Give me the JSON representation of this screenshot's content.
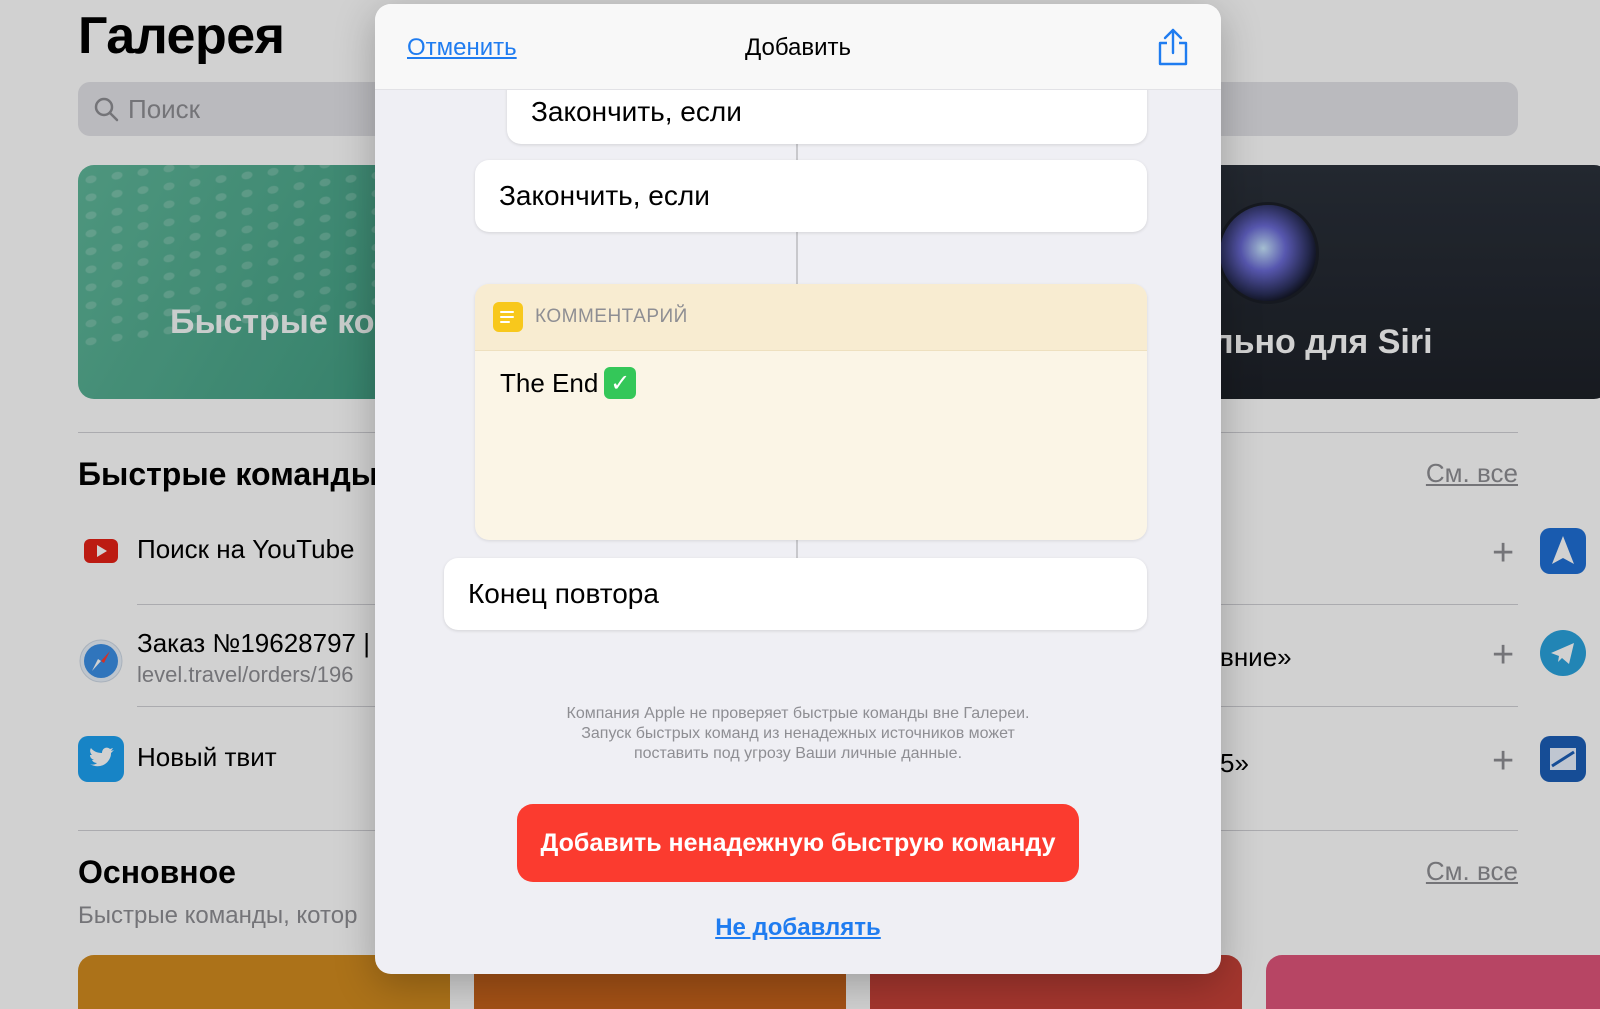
{
  "background": {
    "title": "Галерея",
    "search_placeholder": "Поиск",
    "banner_left_text": "Быстрые ком",
    "banner_right_text": "льно для Siri",
    "section1": {
      "title": "Быстрые команды",
      "see_all": "См. все",
      "rows": [
        {
          "title": "Поиск на YouTube",
          "subtitle": ""
        },
        {
          "title": "Заказ №19628797 |",
          "subtitle": "level.travel/orders/196"
        },
        {
          "title": "Новый твит",
          "subtitle": ""
        }
      ],
      "right_rows": [
        {
          "text": ""
        },
        {
          "text": "вние»"
        },
        {
          "text": "5»"
        }
      ]
    },
    "section2": {
      "title": "Основное",
      "subtitle": "Быстрые команды, котор",
      "see_all": "См. все"
    },
    "colors": {
      "tile1": "#d28b1f",
      "tile2": "#c7631c",
      "tile3": "#c94239",
      "tile4": "#e0557a"
    }
  },
  "modal": {
    "cancel": "Отменить",
    "title": "Добавить",
    "share_icon": "share-icon",
    "actions": {
      "end_if_1": "Закончить, если",
      "end_if_2": "Закончить, если",
      "comment_label": "КОММЕНТАРИЙ",
      "comment_text": "The End",
      "comment_emoji": "✓",
      "end_repeat": "Конец повтора"
    },
    "warning": "Компания Apple не проверяет быстрые команды вне Галереи.\nЗапуск быстрых команд из ненадежных источников может\nпоставить под угрозу Ваши личные данные.",
    "add_button": "Добавить ненадежную быструю команду",
    "dont_add": "Не добавлять",
    "colors": {
      "accent": "#1f7cf0",
      "danger": "#fb3b2f",
      "comment_icon": "#f8c81c"
    }
  }
}
